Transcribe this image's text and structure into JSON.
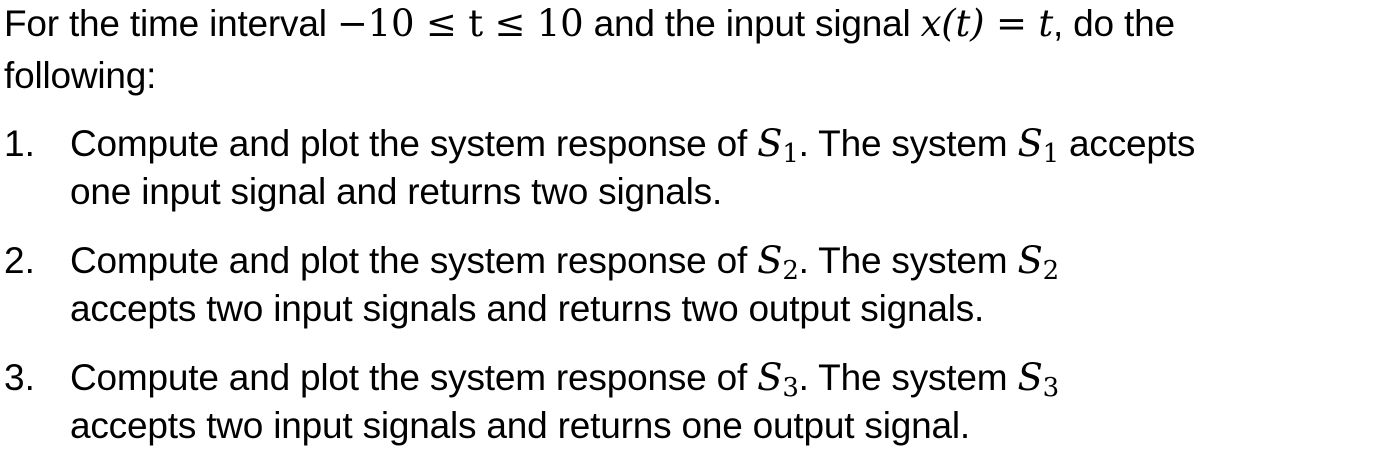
{
  "intro": {
    "line1_a": "For the time interval ",
    "math_interval": "−10 ≤ t ≤  10",
    "line1_b": " and the input signal ",
    "math_signal": "x(t) = t",
    "line1_c": ", do the",
    "line2": "following:"
  },
  "items": [
    {
      "number": "1.",
      "text_a": "Compute and plot the system response of ",
      "sys": "S",
      "sub": "1",
      "text_b": ". The system ",
      "text_c": " accepts",
      "line2": "one input signal and returns two signals."
    },
    {
      "number": "2.",
      "text_a": "Compute and plot the system response of ",
      "sys": "S",
      "sub": "2",
      "text_b": ". The system ",
      "text_c": "",
      "line2": "accepts two input signals and returns two output signals."
    },
    {
      "number": "3.",
      "text_a": "Compute and plot the system response of ",
      "sys": "S",
      "sub": "3",
      "text_b": ". The system ",
      "text_c": "",
      "line2": "accepts two input signals and returns one output signal."
    }
  ]
}
